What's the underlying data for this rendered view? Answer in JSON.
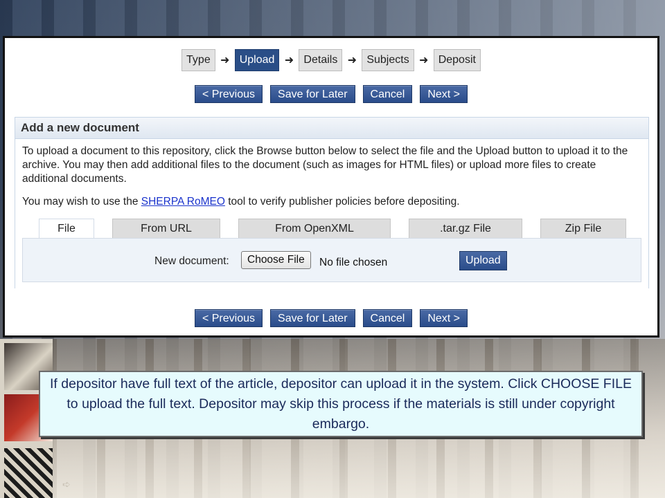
{
  "wizard": {
    "steps": [
      {
        "label": "Type",
        "active": false
      },
      {
        "label": "Upload",
        "active": true
      },
      {
        "label": "Details",
        "active": false
      },
      {
        "label": "Subjects",
        "active": false
      },
      {
        "label": "Deposit",
        "active": false
      }
    ],
    "arrow_glyph": "➜"
  },
  "nav": {
    "previous": "< Previous",
    "save_later": "Save for Later",
    "cancel": "Cancel",
    "next": "Next >"
  },
  "add_document": {
    "title": "Add a new document",
    "instructions": "To upload a document to this repository, click the Browse button below to select the file and the Upload button to upload it to the archive. You may then add additional files to the document (such as images for HTML files) or upload more files to create additional documents.",
    "policy_prefix": "You may wish to use the ",
    "policy_link": "SHERPA RoMEO",
    "policy_suffix": " tool to verify publisher policies before depositing.",
    "tabs": [
      "File",
      "From URL",
      "From OpenXML",
      ".tar.gz File",
      "Zip File"
    ],
    "active_tab": "File",
    "new_document_label": "New document:",
    "choose_file_label": "Choose File",
    "no_file_text": "No file chosen",
    "upload_label": "Upload"
  },
  "callout": {
    "text": "If depositor have full text of the article, depositor can upload it in the system. Click CHOOSE FILE to upload the full text. Depositor may skip this process if the materials is still under copyright embargo."
  },
  "decoration": {
    "slide_arrow_glyph": "➪"
  },
  "colors": {
    "accent": "#2a4e87",
    "callout_bg": "#e6fbfd",
    "link": "#1a33cc"
  }
}
